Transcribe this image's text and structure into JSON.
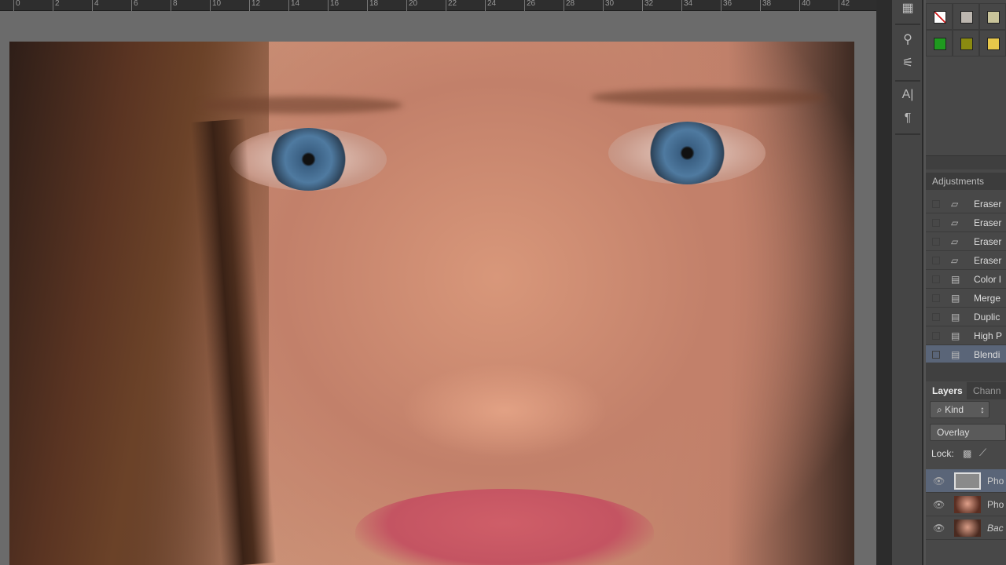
{
  "ruler": {
    "ticks": [
      "0",
      "2",
      "4",
      "6",
      "8",
      "10",
      "12",
      "14",
      "16",
      "18",
      "20",
      "22",
      "24",
      "26",
      "28",
      "30",
      "32",
      "34",
      "36",
      "38",
      "40",
      "42",
      "4"
    ]
  },
  "toolbar": {
    "tools": [
      {
        "icon": "properties-icon",
        "glyph": "▦"
      },
      {
        "icon": "brush-presets-icon",
        "glyph": "⚲"
      },
      {
        "icon": "tool-presets-icon",
        "glyph": "⚟"
      },
      {
        "icon": "character-icon",
        "glyph": "A|"
      },
      {
        "icon": "paragraph-icon",
        "glyph": "¶"
      }
    ]
  },
  "swatches": {
    "colors": [
      "#ffffff",
      "#bdb7b0",
      "#c9c49a",
      "#1f9a1f",
      "#8a8a10",
      "#e8c84a"
    ]
  },
  "adjustments": {
    "title": "Adjustments"
  },
  "history": {
    "items": [
      {
        "label": "Eraser",
        "icon": "eraser-icon",
        "glyph": "▱"
      },
      {
        "label": "Eraser",
        "icon": "eraser-icon",
        "glyph": "▱"
      },
      {
        "label": "Eraser",
        "icon": "eraser-icon",
        "glyph": "▱"
      },
      {
        "label": "Eraser",
        "icon": "eraser-icon",
        "glyph": "▱"
      },
      {
        "label": "Color l",
        "icon": "document-icon",
        "glyph": "▤"
      },
      {
        "label": "Merge",
        "icon": "document-icon",
        "glyph": "▤"
      },
      {
        "label": "Duplic",
        "icon": "document-icon",
        "glyph": "▤"
      },
      {
        "label": "High P",
        "icon": "document-icon",
        "glyph": "▤"
      },
      {
        "label": "Blendi",
        "icon": "document-icon",
        "glyph": "▤",
        "selected": true
      }
    ]
  },
  "layers_panel": {
    "tab_layers": "Layers",
    "tab_channels": "Chann",
    "kind_label": "Kind",
    "blend_mode": "Overlay",
    "lock_label": "Lock:",
    "layers": [
      {
        "name": "Pho",
        "selected": true
      },
      {
        "name": "Pho"
      },
      {
        "name": "Bac"
      }
    ]
  }
}
